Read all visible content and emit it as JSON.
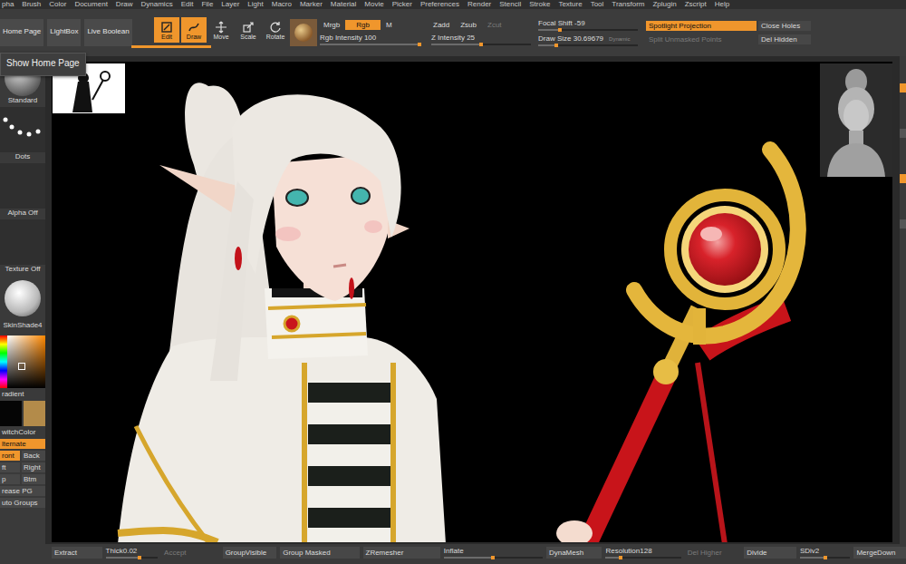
{
  "menu": [
    "pha",
    "Brush",
    "Color",
    "Document",
    "Draw",
    "Dynamics",
    "Edit",
    "File",
    "Layer",
    "Light",
    "Macro",
    "Marker",
    "Material",
    "Movie",
    "Picker",
    "Preferences",
    "Render",
    "Stencil",
    "Stroke",
    "Texture",
    "Tool",
    "Transform",
    "Zplugin",
    "Zscript",
    "Help"
  ],
  "tooltip": "Show Home Page",
  "top_shelf": {
    "buttons": [
      {
        "label": "Home Page",
        "selected": false
      },
      {
        "label": "LightBox",
        "selected": false
      },
      {
        "label": "Live Boolean",
        "selected": false
      }
    ],
    "transform_tools": [
      {
        "kind": "edit",
        "label": "Edit",
        "selected": true
      },
      {
        "kind": "draw",
        "label": "Draw",
        "selected": true
      },
      {
        "kind": "move",
        "label": "Move",
        "selected": false
      },
      {
        "kind": "scale",
        "label": "Scale",
        "selected": false
      },
      {
        "kind": "rotate",
        "label": "Rotate",
        "selected": false
      }
    ],
    "rgb_modes": [
      {
        "label": "Mrgb",
        "selected": false
      },
      {
        "label": "Rgb",
        "selected": true
      },
      {
        "label": "M",
        "selected": false
      }
    ],
    "rgb_intensity": {
      "label": "Rgb Intensity",
      "value": "100",
      "level": 1.0
    },
    "z_modes": [
      {
        "label": "Zadd",
        "selected": false,
        "disabled": false
      },
      {
        "label": "Zsub",
        "selected": false,
        "disabled": false
      },
      {
        "label": "Zcut",
        "selected": false,
        "disabled": true
      }
    ],
    "z_intensity": {
      "label": "Z Intensity",
      "value": "25",
      "level": 0.5
    },
    "focal_shift": {
      "label": "Focal Shift",
      "value": "-59",
      "level": 0.22
    },
    "draw_size": {
      "label": "Draw Size",
      "value": "30.69679",
      "level": 0.18
    },
    "dynamic": "Dynamic",
    "options": [
      {
        "label": "Spotlight Projection",
        "selected": true,
        "disabled": false
      },
      {
        "label": "Split Unmasked Points",
        "selected": false,
        "disabled": true
      }
    ],
    "actions": [
      {
        "label": "Close Holes",
        "disabled": false
      },
      {
        "label": "Del Hidden",
        "disabled": false
      }
    ]
  },
  "left_shelf": {
    "brush": "Standard",
    "stroke": "Dots",
    "alpha": "Alpha Off",
    "texture": "Texture Off",
    "material": "SkinShade4",
    "gradient": "radient",
    "swatches": [
      {
        "color": "#050505"
      },
      {
        "color": "#b38b4a"
      }
    ],
    "switch_color": "witchColor",
    "alternate": {
      "label": "lternate",
      "selected": true
    },
    "views": [
      {
        "label": "ront",
        "selected": true
      },
      {
        "label": "Back",
        "selected": false
      },
      {
        "label": "ft",
        "selected": false
      },
      {
        "label": "Right",
        "selected": false
      },
      {
        "label": "p",
        "selected": false
      },
      {
        "label": "Btm",
        "selected": false
      }
    ],
    "buttons": [
      "rease PG",
      "uto Groups"
    ]
  },
  "bottom_bar": [
    {
      "kind": "button",
      "label": "Extract",
      "disabled": false
    },
    {
      "kind": "slider",
      "label": "Thick",
      "value": "0.02",
      "level": 0.65
    },
    {
      "kind": "button",
      "label": "Accept",
      "disabled": true
    },
    {
      "kind": "button",
      "label": "GroupVisible",
      "disabled": false
    },
    {
      "kind": "button",
      "label": "Group Masked",
      "disabled": false
    },
    {
      "kind": "button",
      "label": "ZRemesher",
      "disabled": false
    },
    {
      "kind": "slider",
      "label": "Inflate",
      "level": 0.5
    },
    {
      "kind": "button",
      "label": "DynaMesh",
      "disabled": false
    },
    {
      "kind": "slider",
      "label": "Resolution",
      "value": "128",
      "level": 0.2
    },
    {
      "kind": "button",
      "label": "Del Higher",
      "disabled": true
    },
    {
      "kind": "button",
      "label": "Divide",
      "disabled": false
    },
    {
      "kind": "slider",
      "label": "SDiv",
      "value": "2",
      "level": 0.5
    },
    {
      "kind": "button",
      "label": "MergeDown",
      "disabled": false
    }
  ]
}
